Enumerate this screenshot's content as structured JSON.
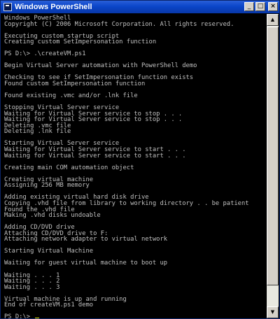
{
  "window": {
    "title": "Windows PowerShell",
    "controls": {
      "minimize": "_",
      "maximize": "□",
      "close": "×"
    },
    "icon": "powershell-icon"
  },
  "colors": {
    "console_bg": "#000000",
    "console_text": "#c0c0c0",
    "titlebar": "#0b46c9",
    "cursor": "#e5e500"
  },
  "console": {
    "lines": [
      "Windows PowerShell",
      "Copyright (C) 2006 Microsoft Corporation. All rights reserved.",
      "",
      "Executing custom startup script",
      "Creating custom SetImpersonation function",
      "",
      "PS D:\\> .\\createVM.ps1",
      "",
      "Begin Virtual Server automation with PowerShell demo",
      "",
      "Checking to see if SetImpersonation function exists",
      "Found custom SetImpersonation function",
      "",
      "Found existing .vmc and/or .lnk file",
      "",
      "Stopping Virtual Server service",
      "Waiting for Virtual Server service to stop . . .",
      "Waiting for Virtual Server service to stop . . .",
      "Deleting .vmc file",
      "Deleting .lnk file",
      "",
      "Starting Virtual Server service",
      "Waiting for Virtual Server service to start . . .",
      "Waiting for Virtual Server service to start . . .",
      "",
      "Creating main COM automation object",
      "",
      "Creating virtual machine",
      "Assigning 256 MB memory",
      "",
      "Adding existing virtual hard disk drive",
      "Copying .vhd file from library to working directory . . be patient",
      "Found the .vhd file",
      "Making .vhd disks undoable",
      "",
      "Adding CD/DVD drive",
      "Attaching CD/DVD drive to F:",
      "Attaching network adapter to virtual network",
      "",
      "Starting Virtual Machine",
      "",
      "Waiting for guest virtual machine to boot up",
      "",
      "Waiting . . . 1",
      "Waiting . . . 2",
      "Waiting . . . 3",
      "",
      "Virtual machine is up and running",
      "End of createVM.ps1 demo",
      ""
    ],
    "prompt": "PS D:\\>"
  }
}
